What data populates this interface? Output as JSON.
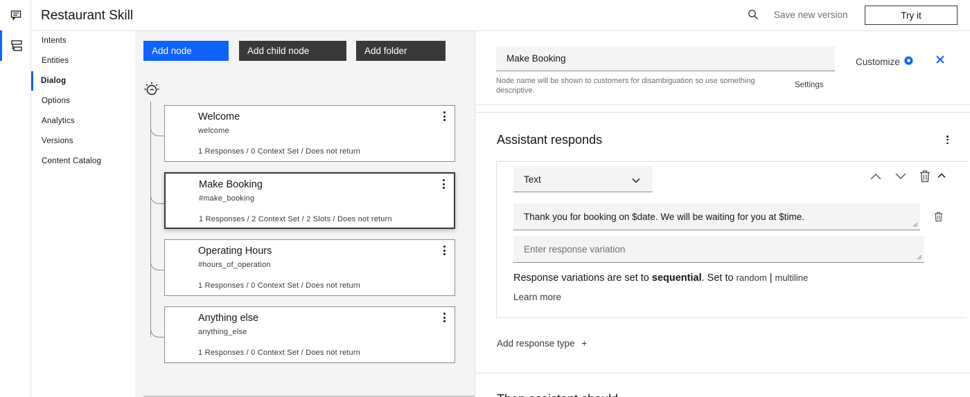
{
  "app": {
    "title": "Restaurant Skill",
    "save_version_label": "Save new version",
    "try_it_label": "Try it"
  },
  "nav": {
    "items": [
      {
        "label": "Intents"
      },
      {
        "label": "Entities"
      },
      {
        "label": "Dialog"
      },
      {
        "label": "Options"
      },
      {
        "label": "Analytics"
      },
      {
        "label": "Versions"
      },
      {
        "label": "Content Catalog"
      }
    ]
  },
  "toolbar": {
    "add_node": "Add node",
    "add_child_node": "Add child node",
    "add_folder": "Add folder"
  },
  "nodes": [
    {
      "name": "Welcome",
      "condition": "welcome",
      "meta": "1 Responses / 0 Context Set / Does not return"
    },
    {
      "name": "Make Booking",
      "condition": "#make_booking",
      "meta": "1 Responses / 2 Context Set / 2 Slots / Does not return"
    },
    {
      "name": "Operating Hours",
      "condition": "#hours_of_operation",
      "meta": "1 Responses / 0 Context Set / Does not return"
    },
    {
      "name": "Anything else",
      "condition": "anything_else",
      "meta": "1 Responses / 0 Context Set / Does not return"
    }
  ],
  "editor": {
    "node_name": "Make Booking",
    "helper": "Node name will be shown to customers for disambiguation so use something descriptive.",
    "settings": "Settings",
    "customize": "Customize",
    "section_title": "Assistant responds",
    "response_type": "Text",
    "response_text": "Thank you for booking on $date. We will be waiting for you at $time.",
    "variation_placeholder": "Enter response variation",
    "variations_prefix": "Response variations are set to ",
    "variations_mode": "sequential",
    "variations_mid": ". Set to ",
    "opt_random": "random",
    "opt_sep": " | ",
    "opt_multiline": "multiline",
    "learn_more": "Learn more",
    "add_response_type": "Add response type",
    "add_symbol": "+",
    "next_section": "Then assistant should"
  },
  "colors": {
    "accent": "#0f62fe",
    "dark_button": "#393939"
  }
}
